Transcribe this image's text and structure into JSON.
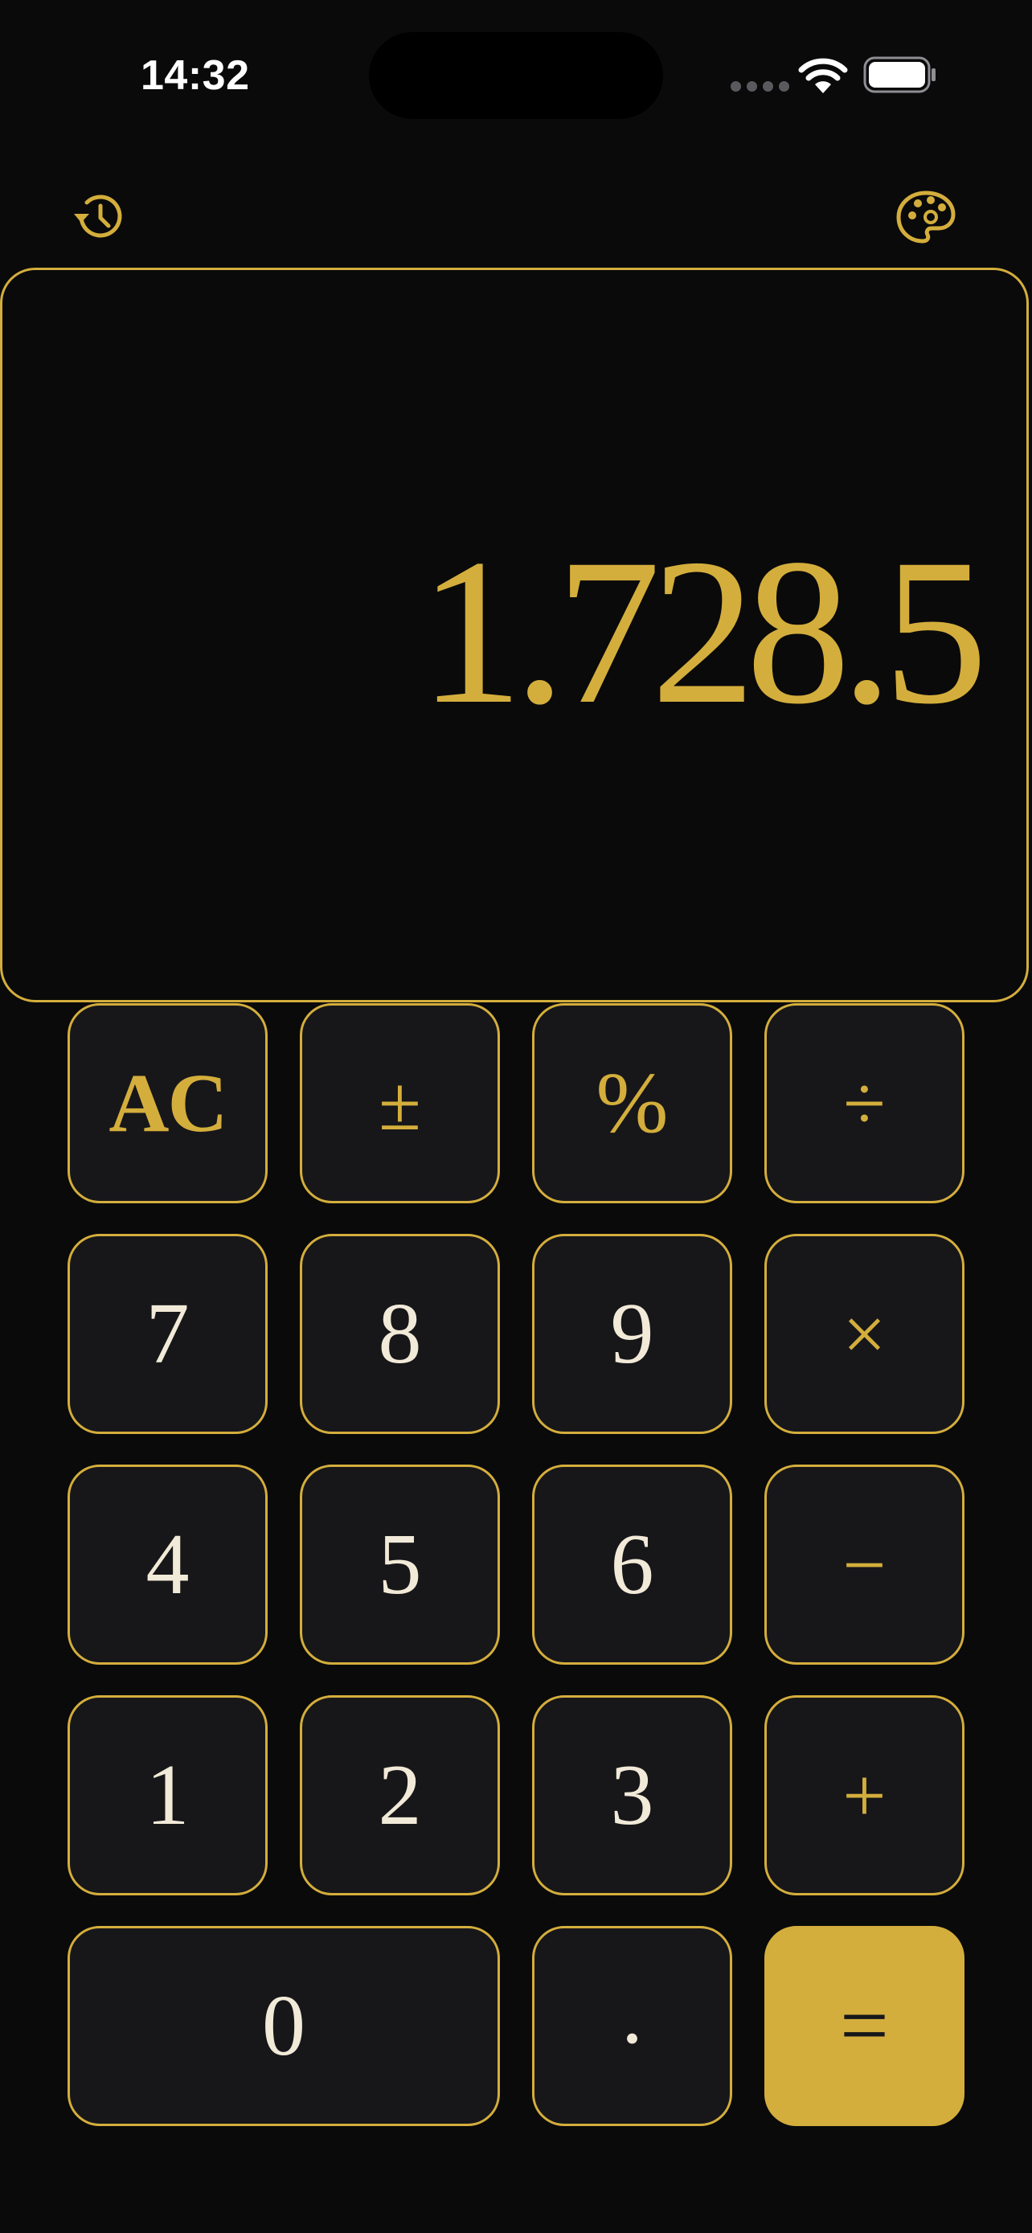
{
  "status_bar": {
    "time": "14:32"
  },
  "toolbar": {
    "history_icon": "history-icon",
    "theme_icon": "palette-icon"
  },
  "display": {
    "value": "1.728.5"
  },
  "colors": {
    "accent": "#d4ae3c",
    "background": "#0a0a0b",
    "key_background": "#17171a",
    "digit_text": "#f2ead8"
  },
  "keypad": {
    "ac": "AC",
    "plus_minus": "±",
    "percent": "%",
    "divide": "÷",
    "seven": "7",
    "eight": "8",
    "nine": "9",
    "multiply": "×",
    "four": "4",
    "five": "5",
    "six": "6",
    "minus": "−",
    "one": "1",
    "two": "2",
    "three": "3",
    "plus": "+",
    "zero": "0",
    "decimal": ".",
    "equals": "="
  }
}
